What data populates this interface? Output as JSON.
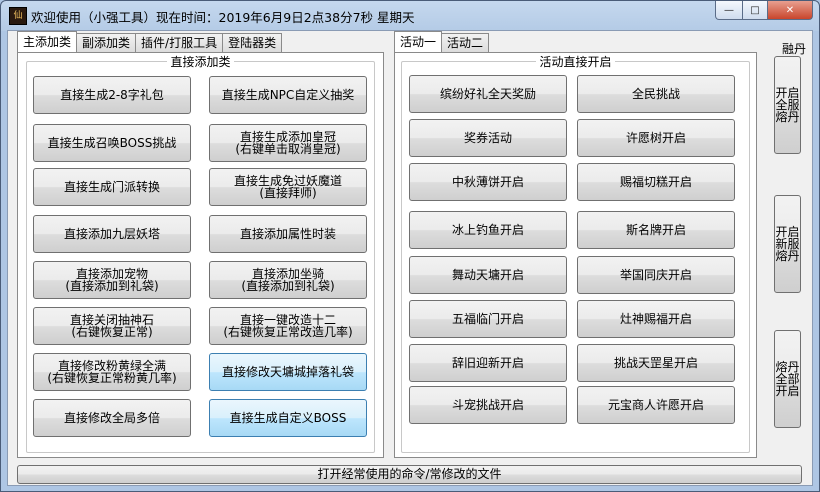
{
  "window": {
    "title": "欢迎使用（小强工具）现在时间：2019年6月9日2点38分7秒  星期天",
    "icon": "app-logo-icon",
    "controls": {
      "minimize": "—",
      "maximize": "□",
      "close": "✕"
    }
  },
  "left_tabs": [
    {
      "label": "主添加类",
      "active": true
    },
    {
      "label": "副添加类",
      "active": false
    },
    {
      "label": "插件/打服工具",
      "active": false
    },
    {
      "label": "登陆器类",
      "active": false
    }
  ],
  "left_group_title": "直接添加类",
  "left_buttons": [
    {
      "lines": [
        "直接生成2-8字礼包"
      ]
    },
    {
      "lines": [
        "直接生成NPC自定义抽奖"
      ]
    },
    {
      "lines": [
        "直接生成召唤BOSS挑战"
      ]
    },
    {
      "lines": [
        "直接生成添加皇冠",
        "(右键单击取消皇冠)"
      ]
    },
    {
      "lines": [
        "直接生成门派转换"
      ]
    },
    {
      "lines": [
        "直接生成免过妖魔道",
        "(直接拜师)"
      ]
    },
    {
      "lines": [
        "直接添加九层妖塔"
      ]
    },
    {
      "lines": [
        "直接添加属性时装"
      ]
    },
    {
      "lines": [
        "直接添加宠物",
        "(直接添加到礼袋)"
      ]
    },
    {
      "lines": [
        "直接添加坐骑",
        "(直接添加到礼袋)"
      ]
    },
    {
      "lines": [
        "直接关闭抽神石",
        "(右键恢复正常)"
      ]
    },
    {
      "lines": [
        "直接一键改造十二",
        "(右键恢复正常改造几率)"
      ]
    },
    {
      "lines": [
        "直接修改粉黄绿全满",
        "(右键恢复正常粉黄几率)"
      ]
    },
    {
      "lines": [
        "直接修改天墉城掉落礼袋"
      ]
    },
    {
      "lines": [
        "直接修改全局多倍"
      ]
    },
    {
      "lines": [
        "直接生成自定义BOSS"
      ]
    }
  ],
  "right_tabs": [
    {
      "label": "活动一",
      "active": true
    },
    {
      "label": "活动二",
      "active": false
    }
  ],
  "right_group_title": "活动直接开启",
  "right_buttons": [
    "缤纷好礼全天奖励",
    "全民挑战",
    "奖券活动",
    "许愿树开启",
    "中秋薄饼开启",
    "赐福切糕开启",
    "冰上钓鱼开启",
    "斯名牌开启",
    "舞动天墉开启",
    "举国同庆开启",
    "五福临门开启",
    "灶神赐福开启",
    "辞旧迎新开启",
    "挑战天罡星开启",
    "斗宠挑战开启",
    "元宝商人许愿开启"
  ],
  "side": {
    "label": "融丹",
    "buttons": [
      [
        "开启",
        "全服",
        "熔丹"
      ],
      [
        "开启",
        "新服",
        "熔丹"
      ],
      [
        "熔丹",
        "全部",
        "开启"
      ]
    ]
  },
  "bottom_button": "打开经常使用的命令/常修改的文件",
  "colors": {
    "title_bar": "#aec6e4",
    "close_button": "#c9452c",
    "highlight_button": "#bee6fd"
  }
}
